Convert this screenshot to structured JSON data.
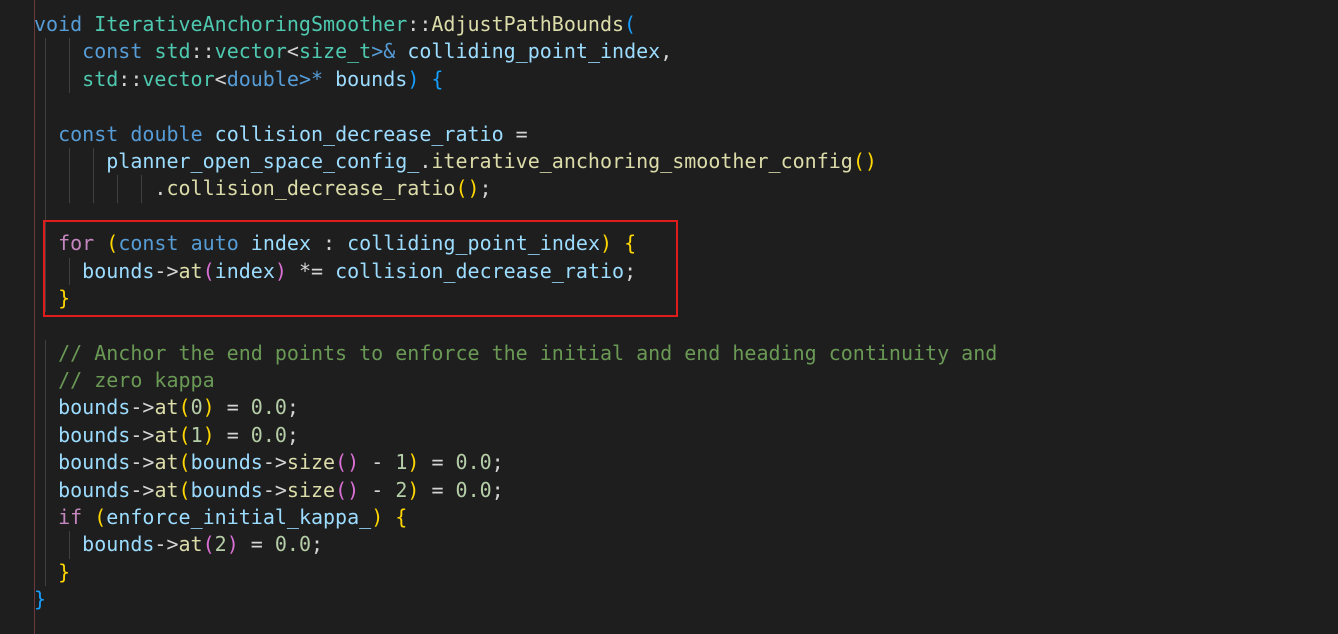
{
  "editor": {
    "highlight_color": "#e01b1b",
    "theme": "dark",
    "lines": [
      {
        "indent": 0,
        "tokens": [
          {
            "t": "void",
            "c": "kw"
          },
          {
            "t": " ",
            "c": "op"
          },
          {
            "t": "IterativeAnchoringSmoother",
            "c": "ty"
          },
          {
            "t": "::",
            "c": "op"
          },
          {
            "t": "AdjustPathBounds",
            "c": "fn"
          },
          {
            "t": "(",
            "c": "b3"
          }
        ]
      },
      {
        "indent": 4,
        "tokens": [
          {
            "t": "const",
            "c": "kw"
          },
          {
            "t": " ",
            "c": "op"
          },
          {
            "t": "std",
            "c": "ty"
          },
          {
            "t": "::",
            "c": "op"
          },
          {
            "t": "vector",
            "c": "ty"
          },
          {
            "t": "<",
            "c": "op"
          },
          {
            "t": "size_t",
            "c": "ty"
          },
          {
            "t": ">& ",
            "c": "kw"
          },
          {
            "t": "colliding_point_index",
            "c": "var"
          },
          {
            "t": ",",
            "c": "op"
          }
        ]
      },
      {
        "indent": 4,
        "tokens": [
          {
            "t": "std",
            "c": "ty"
          },
          {
            "t": "::",
            "c": "op"
          },
          {
            "t": "vector",
            "c": "ty"
          },
          {
            "t": "<",
            "c": "op"
          },
          {
            "t": "double",
            "c": "kw"
          },
          {
            "t": ">* ",
            "c": "kw"
          },
          {
            "t": "bounds",
            "c": "var"
          },
          {
            "t": ")",
            "c": "b3"
          },
          {
            "t": " ",
            "c": "op"
          },
          {
            "t": "{",
            "c": "b3"
          }
        ]
      },
      {
        "indent": 2,
        "tokens": []
      },
      {
        "indent": 2,
        "tokens": [
          {
            "t": "const",
            "c": "kw"
          },
          {
            "t": " ",
            "c": "op"
          },
          {
            "t": "double",
            "c": "kw"
          },
          {
            "t": " ",
            "c": "op"
          },
          {
            "t": "collision_decrease_ratio",
            "c": "var"
          },
          {
            "t": " =",
            "c": "op"
          }
        ]
      },
      {
        "indent": 6,
        "tokens": [
          {
            "t": "planner_open_space_config_",
            "c": "var"
          },
          {
            "t": ".",
            "c": "op"
          },
          {
            "t": "iterative_anchoring_smoother_config",
            "c": "fn"
          },
          {
            "t": "()",
            "c": "b1"
          }
        ]
      },
      {
        "indent": 10,
        "tokens": [
          {
            "t": ".",
            "c": "op"
          },
          {
            "t": "collision_decrease_ratio",
            "c": "fn"
          },
          {
            "t": "()",
            "c": "b1"
          },
          {
            "t": ";",
            "c": "op"
          }
        ]
      },
      {
        "indent": 2,
        "tokens": []
      },
      {
        "indent": 2,
        "tokens": [
          {
            "t": "for",
            "c": "ctl"
          },
          {
            "t": " ",
            "c": "op"
          },
          {
            "t": "(",
            "c": "b1"
          },
          {
            "t": "const",
            "c": "kw"
          },
          {
            "t": " ",
            "c": "op"
          },
          {
            "t": "auto",
            "c": "kw"
          },
          {
            "t": " ",
            "c": "op"
          },
          {
            "t": "index",
            "c": "var"
          },
          {
            "t": " : ",
            "c": "op"
          },
          {
            "t": "colliding_point_index",
            "c": "var"
          },
          {
            "t": ")",
            "c": "b1"
          },
          {
            "t": " ",
            "c": "op"
          },
          {
            "t": "{",
            "c": "b1"
          }
        ]
      },
      {
        "indent": 4,
        "tokens": [
          {
            "t": "bounds",
            "c": "var"
          },
          {
            "t": "->",
            "c": "op"
          },
          {
            "t": "at",
            "c": "fn"
          },
          {
            "t": "(",
            "c": "b2"
          },
          {
            "t": "index",
            "c": "var"
          },
          {
            "t": ")",
            "c": "b2"
          },
          {
            "t": " *= ",
            "c": "op"
          },
          {
            "t": "collision_decrease_ratio",
            "c": "var"
          },
          {
            "t": ";",
            "c": "op"
          }
        ]
      },
      {
        "indent": 2,
        "tokens": [
          {
            "t": "}",
            "c": "b1"
          }
        ]
      },
      {
        "indent": 0,
        "tokens": []
      },
      {
        "indent": 2,
        "tokens": [
          {
            "t": "// Anchor the end points to enforce the initial and end heading continuity and",
            "c": "cmt"
          }
        ]
      },
      {
        "indent": 2,
        "tokens": [
          {
            "t": "// zero kappa",
            "c": "cmt"
          }
        ]
      },
      {
        "indent": 2,
        "tokens": [
          {
            "t": "bounds",
            "c": "var"
          },
          {
            "t": "->",
            "c": "op"
          },
          {
            "t": "at",
            "c": "fn"
          },
          {
            "t": "(",
            "c": "b1"
          },
          {
            "t": "0",
            "c": "num"
          },
          {
            "t": ")",
            "c": "b1"
          },
          {
            "t": " = ",
            "c": "op"
          },
          {
            "t": "0.0",
            "c": "num"
          },
          {
            "t": ";",
            "c": "op"
          }
        ]
      },
      {
        "indent": 2,
        "tokens": [
          {
            "t": "bounds",
            "c": "var"
          },
          {
            "t": "->",
            "c": "op"
          },
          {
            "t": "at",
            "c": "fn"
          },
          {
            "t": "(",
            "c": "b1"
          },
          {
            "t": "1",
            "c": "num"
          },
          {
            "t": ")",
            "c": "b1"
          },
          {
            "t": " = ",
            "c": "op"
          },
          {
            "t": "0.0",
            "c": "num"
          },
          {
            "t": ";",
            "c": "op"
          }
        ]
      },
      {
        "indent": 2,
        "tokens": [
          {
            "t": "bounds",
            "c": "var"
          },
          {
            "t": "->",
            "c": "op"
          },
          {
            "t": "at",
            "c": "fn"
          },
          {
            "t": "(",
            "c": "b1"
          },
          {
            "t": "bounds",
            "c": "var"
          },
          {
            "t": "->",
            "c": "op"
          },
          {
            "t": "size",
            "c": "fn"
          },
          {
            "t": "()",
            "c": "b2"
          },
          {
            "t": " - ",
            "c": "op"
          },
          {
            "t": "1",
            "c": "num"
          },
          {
            "t": ")",
            "c": "b1"
          },
          {
            "t": " = ",
            "c": "op"
          },
          {
            "t": "0.0",
            "c": "num"
          },
          {
            "t": ";",
            "c": "op"
          }
        ]
      },
      {
        "indent": 2,
        "tokens": [
          {
            "t": "bounds",
            "c": "var"
          },
          {
            "t": "->",
            "c": "op"
          },
          {
            "t": "at",
            "c": "fn"
          },
          {
            "t": "(",
            "c": "b1"
          },
          {
            "t": "bounds",
            "c": "var"
          },
          {
            "t": "->",
            "c": "op"
          },
          {
            "t": "size",
            "c": "fn"
          },
          {
            "t": "()",
            "c": "b2"
          },
          {
            "t": " - ",
            "c": "op"
          },
          {
            "t": "2",
            "c": "num"
          },
          {
            "t": ")",
            "c": "b1"
          },
          {
            "t": " = ",
            "c": "op"
          },
          {
            "t": "0.0",
            "c": "num"
          },
          {
            "t": ";",
            "c": "op"
          }
        ]
      },
      {
        "indent": 2,
        "tokens": [
          {
            "t": "if",
            "c": "ctl"
          },
          {
            "t": " ",
            "c": "op"
          },
          {
            "t": "(",
            "c": "b1"
          },
          {
            "t": "enforce_initial_kappa_",
            "c": "var"
          },
          {
            "t": ")",
            "c": "b1"
          },
          {
            "t": " ",
            "c": "op"
          },
          {
            "t": "{",
            "c": "b1"
          }
        ]
      },
      {
        "indent": 4,
        "tokens": [
          {
            "t": "bounds",
            "c": "var"
          },
          {
            "t": "->",
            "c": "op"
          },
          {
            "t": "at",
            "c": "fn"
          },
          {
            "t": "(",
            "c": "b2"
          },
          {
            "t": "2",
            "c": "num"
          },
          {
            "t": ")",
            "c": "b2"
          },
          {
            "t": " = ",
            "c": "op"
          },
          {
            "t": "0.0",
            "c": "num"
          },
          {
            "t": ";",
            "c": "op"
          }
        ]
      },
      {
        "indent": 2,
        "tokens": [
          {
            "t": "}",
            "c": "b1"
          }
        ]
      },
      {
        "indent": 0,
        "tokens": [
          {
            "t": "}",
            "c": "b3"
          }
        ]
      }
    ]
  }
}
